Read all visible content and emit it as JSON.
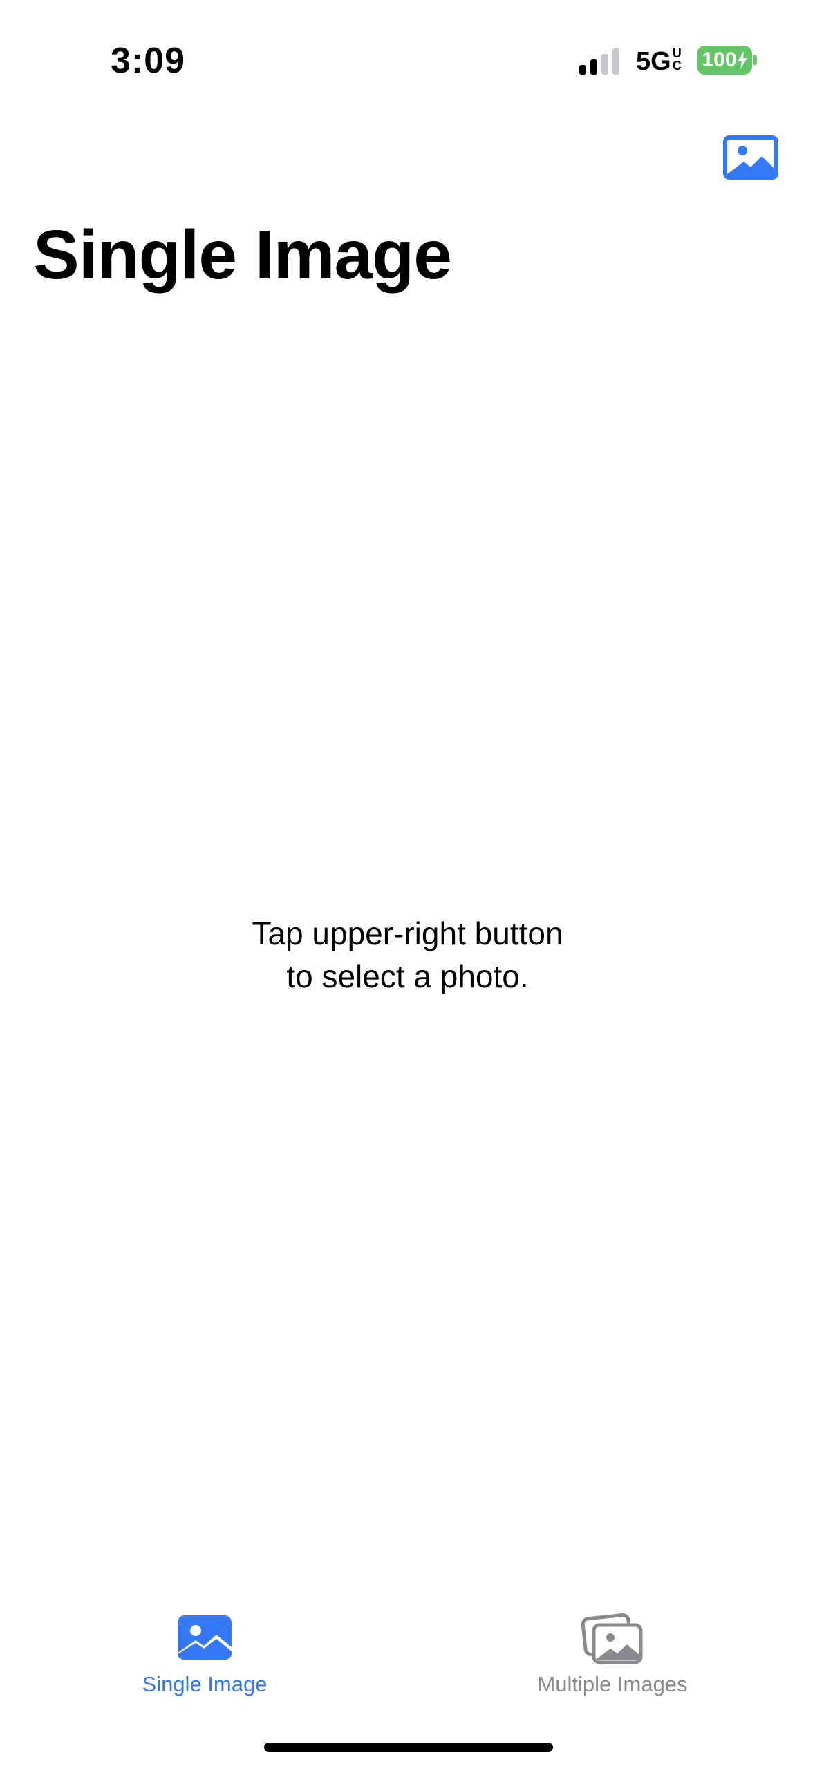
{
  "status_bar": {
    "time": "3:09",
    "network": "5G",
    "network_suffix": [
      "U",
      "C"
    ],
    "battery": "100"
  },
  "nav": {
    "title": "Single Image",
    "photo_button_icon": "photo-icon"
  },
  "main": {
    "message_line1": "Tap upper-right button",
    "message_line2": "to select a photo."
  },
  "tabs": [
    {
      "label": "Single Image",
      "icon": "photo-icon",
      "selected": true
    },
    {
      "label": "Multiple Images",
      "icon": "photo-stack-icon",
      "selected": false
    }
  ],
  "colors": {
    "accent": "#3478f6",
    "inactive": "#8a8a8e",
    "battery": "#65c466"
  }
}
